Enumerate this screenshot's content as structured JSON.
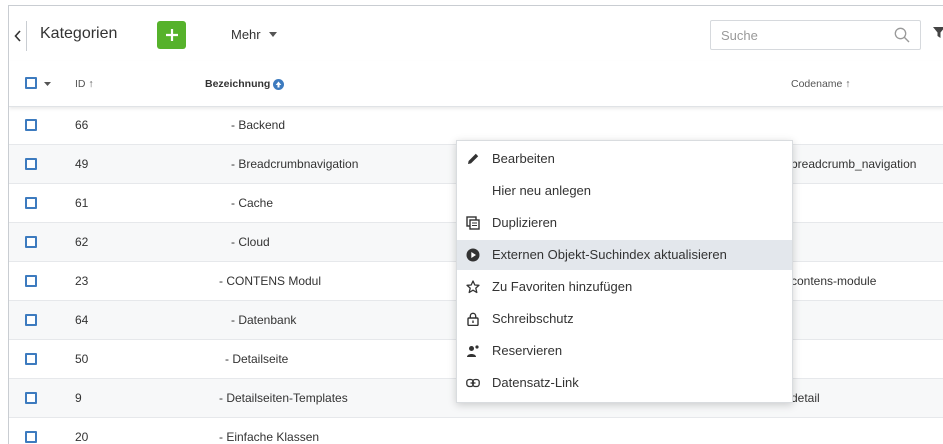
{
  "header": {
    "title": "Kategorien",
    "more_label": "Mehr",
    "search_placeholder": "Suche"
  },
  "columns": {
    "id": "ID ↑",
    "name": "Bezeichnung",
    "codename": "Codename ↑"
  },
  "rows": [
    {
      "id": "66",
      "name": "- Backend",
      "codename": ""
    },
    {
      "id": "49",
      "name": "- Breadcrumbnavigation",
      "codename": "breadcrumb_navigation"
    },
    {
      "id": "61",
      "name": "- Cache",
      "codename": ""
    },
    {
      "id": "62",
      "name": "- Cloud",
      "codename": ""
    },
    {
      "id": "23",
      "name": "- CONTENS Modul",
      "codename": "contens-module"
    },
    {
      "id": "64",
      "name": "- Datenbank",
      "codename": ""
    },
    {
      "id": "50",
      "name": "- Detailseite",
      "codename": ""
    },
    {
      "id": "9",
      "name": "- Detailseiten-Templates",
      "codename": "detail"
    },
    {
      "id": "20",
      "name": "- Einfache Klassen",
      "codename": ""
    }
  ],
  "context_menu": {
    "items": [
      {
        "label": "Bearbeiten",
        "icon": "pencil-icon"
      },
      {
        "label": "Hier neu anlegen",
        "icon": ""
      },
      {
        "label": "Duplizieren",
        "icon": "duplicate-icon"
      },
      {
        "label": "Externen Objekt-Suchindex aktualisieren",
        "icon": "play-circle-icon"
      },
      {
        "label": "Zu Favoriten hinzufügen",
        "icon": "star-icon"
      },
      {
        "label": "Schreibschutz",
        "icon": "lock-icon"
      },
      {
        "label": "Reservieren",
        "icon": "user-reserve-icon"
      },
      {
        "label": "Datensatz-Link",
        "icon": "link-icon"
      }
    ],
    "highlighted_index": 3
  },
  "colors": {
    "accent": "#3d7bbf",
    "add_button": "#56b22b",
    "highlight": "#e3e7ec"
  }
}
